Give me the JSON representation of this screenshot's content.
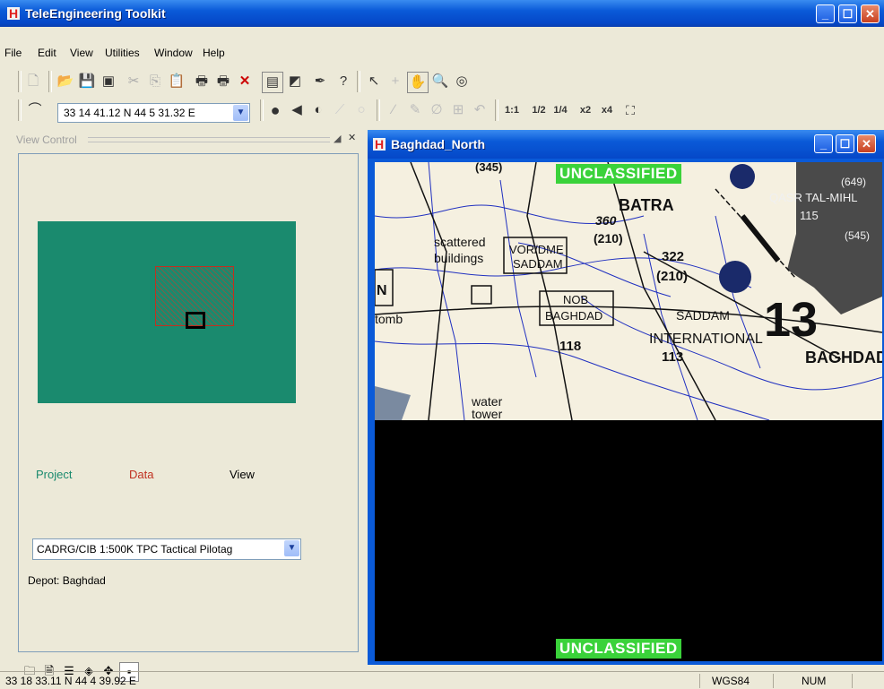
{
  "window": {
    "title": "TeleEngineering Toolkit",
    "app_icon": "H"
  },
  "menu": [
    "File",
    "Edit",
    "View",
    "Utilities",
    "Window",
    "Help"
  ],
  "toolbar2": {
    "coordinate": "33 14 41.12 N  44  5 31.32 E",
    "zoom_1_1": "1:1",
    "zoom_half": "1/2",
    "zoom_quarter": "1/4",
    "zoom_x2": "x2",
    "zoom_x4": "x4"
  },
  "view_control": {
    "header": "View Control",
    "legend": {
      "project": "Project",
      "data": "Data",
      "view": "View"
    },
    "map_select": "CADRG/CIB 1:500K  TPC    Tactical Pilotag",
    "depot": "Depot: Baghdad"
  },
  "child_window": {
    "title": "Baghdad_North",
    "classification_top": "UNCLASSIFIED",
    "classification_bottom": "UNCLASSIFIED",
    "map_labels": [
      "(345)",
      "BATRA",
      "360",
      "(210)",
      "scattered",
      "buildings",
      "VOR/DME",
      "SADDAM",
      "322",
      "(210)",
      "NOB",
      "BAGHDAD",
      "SADDAM",
      "INTERNATIONAL",
      "118",
      "113",
      "13",
      "tomb",
      "water",
      "tower",
      "BAGHDAD",
      "QASR TAL-MIHL",
      "115",
      "(649)",
      "(545)",
      "N"
    ]
  },
  "status": {
    "coords": "33 18 33.11 N  44  4 39.92 E",
    "datum": "WGS84",
    "num": "NUM"
  },
  "colors": {
    "overview": "#1a8a6e",
    "classification": "#3ad23a",
    "project": "#1a8a6e",
    "data": "#c03020"
  }
}
